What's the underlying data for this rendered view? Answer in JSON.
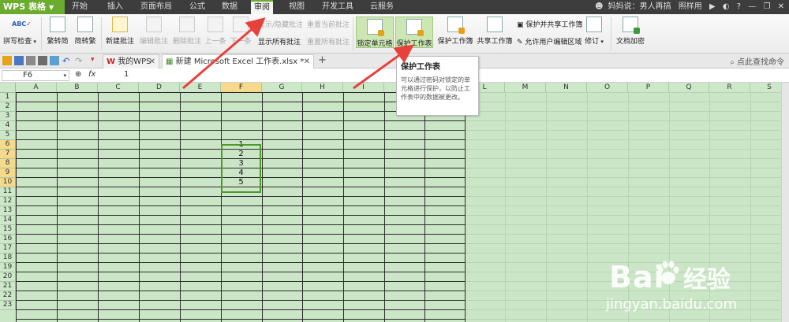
{
  "app": {
    "name": "WPS 表格"
  },
  "menu": {
    "items": [
      "开始",
      "插入",
      "页面布局",
      "公式",
      "数据",
      "审阅",
      "视图",
      "开发工具",
      "云服务"
    ],
    "active": "审阅",
    "user_text": "妈妈说：男人再搞",
    "skin_label": "照样用"
  },
  "ribbon": {
    "spell_check": "拼写检查",
    "to_traditional": "繁转简",
    "to_simplified": "简转繁",
    "new_comment": "新建批注",
    "edit_comment": "编辑批注",
    "delete_comment": "删除批注",
    "prev": "上一条",
    "next": "下一条",
    "show_hide_comment": "显示/隐藏批注",
    "reset_current_comment": "重置当前批注",
    "show_all_comments": "显示所有批注",
    "reset_all_comments": "重置所有批注",
    "lock_cell": "锁定单元格",
    "protect_sheet": "保护工作表",
    "protect_workbook": "保护工作簿",
    "share_workbook": "共享工作簿",
    "protect_and_share": "保护并共享工作簿",
    "allow_user_edit_range": "允许用户编辑区域",
    "revise": "修订",
    "doc_encrypt": "文档加密"
  },
  "tabs": {
    "my_wps": "我的WPS",
    "file_tab": "新建 Microsoft Excel 工作表.xlsx *",
    "search_label": "点此查找命令"
  },
  "formula_bar": {
    "cell_ref": "F6",
    "fx": "fx",
    "value": "1"
  },
  "sheet": {
    "columns": [
      "A",
      "B",
      "C",
      "D",
      "E",
      "F",
      "G",
      "H",
      "I",
      "J",
      "K",
      "L",
      "M",
      "N",
      "O",
      "P",
      "Q",
      "R",
      "S"
    ],
    "rows": [
      "1",
      "2",
      "3",
      "4",
      "5",
      "6",
      "7",
      "8",
      "9",
      "10",
      "11",
      "12",
      "13",
      "14",
      "15",
      "16",
      "17",
      "18",
      "19",
      "20",
      "21",
      "22",
      "23"
    ],
    "selected_column": "F",
    "selected_rows": [
      "6",
      "7",
      "8",
      "9",
      "10"
    ],
    "cells_F": [
      "1",
      "2",
      "3",
      "4",
      "5"
    ]
  },
  "tooltip": {
    "title": "保护工作表",
    "body": "可以通过密码对锁定的单元格进行保护，以防止工作表中的数据被更改。"
  },
  "watermark": {
    "brand": "Bai",
    "brand_tail": "经验",
    "url": "jingyan.baidu.com"
  },
  "colors": {
    "accent": "#6bab2e",
    "arrow": "#e8403a",
    "sheet_bg": "#cbe6c6",
    "selection_border": "#4d9a2a"
  }
}
